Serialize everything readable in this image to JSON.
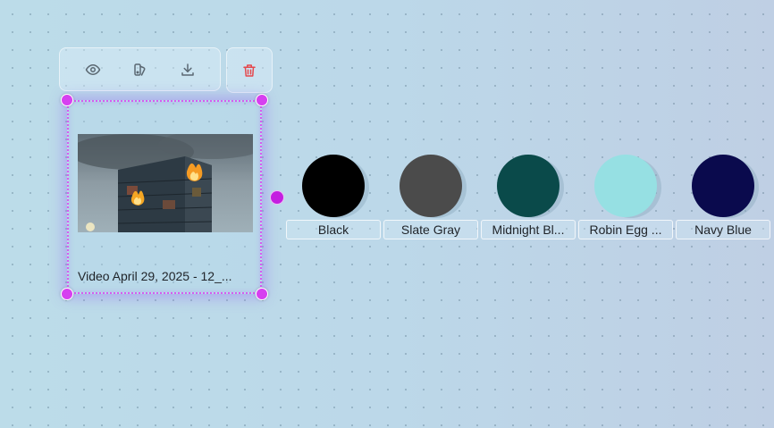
{
  "toolbar": {
    "icons": [
      "eye-icon",
      "layers-icon",
      "download-icon",
      "trash-icon"
    ],
    "delete_color": "#e5484d",
    "icon_color": "#5b6872"
  },
  "node": {
    "label": "Video April 29, 2025 - 12_...",
    "handle_color": "#d63ff0",
    "port_color": "#c41fe0"
  },
  "swatches": [
    {
      "label": "Black",
      "color": "#000000"
    },
    {
      "label": "Slate Gray",
      "color": "#4b4b4b"
    },
    {
      "label": "Midnight Bl...",
      "color": "#0a4a4a"
    },
    {
      "label": "Robin Egg ...",
      "color": "#96e0e3"
    },
    {
      "label": "Navy Blue",
      "color": "#0a0a4d"
    }
  ]
}
